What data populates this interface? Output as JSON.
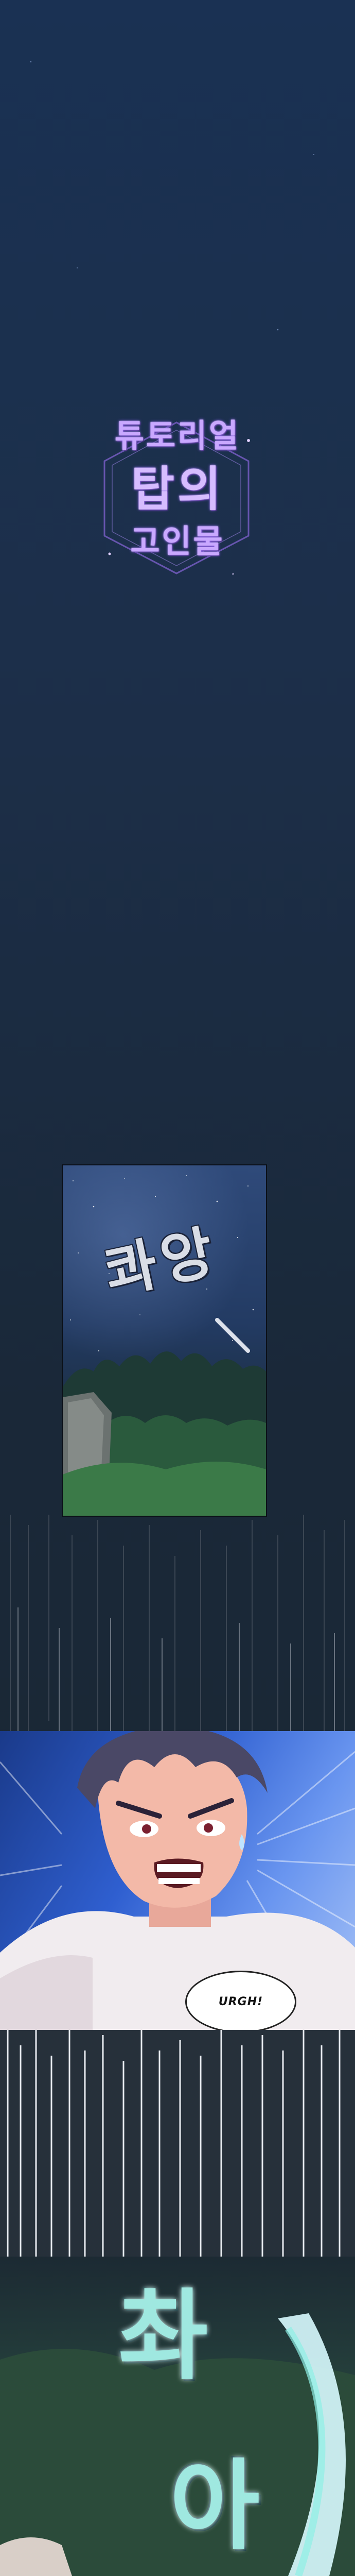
{
  "title_logo": {
    "line1": "튜토리얼",
    "line2": "탑의",
    "line3": "고인물",
    "color": "#c9a8ff"
  },
  "panel_sky": {
    "sfx": "콰앙"
  },
  "panel_hero": {
    "speech": "URGH!"
  },
  "panel_slash": {
    "sfx_top": "촤",
    "sfx_bottom": "아"
  },
  "colors": {
    "bg_top": "#1a3153",
    "bg_bottom": "#1a2632",
    "sky": "#2f4a7a",
    "burst_blue": "#2f5fd0",
    "slash_glow": "#9fe8e0"
  }
}
